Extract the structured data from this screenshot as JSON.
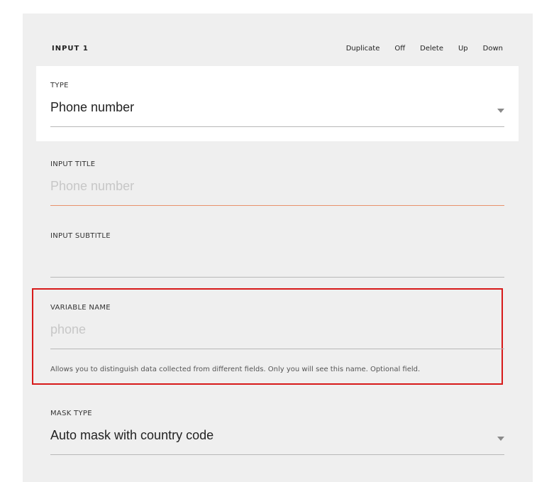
{
  "header": {
    "title": "INPUT 1",
    "actions": [
      "Duplicate",
      "Off",
      "Delete",
      "Up",
      "Down"
    ]
  },
  "fields": {
    "type": {
      "label": "TYPE",
      "value": "Phone number"
    },
    "input_title": {
      "label": "INPUT TITLE",
      "placeholder": "Phone number"
    },
    "input_subtitle": {
      "label": "INPUT SUBTITLE",
      "value": ""
    },
    "variable_name": {
      "label": "VARIABLE NAME",
      "placeholder": "phone",
      "hint": "Allows you to distinguish data collected from different fields. Only you will see this name. Optional field."
    },
    "mask_type": {
      "label": "MASK TYPE",
      "value": "Auto mask with country code"
    }
  },
  "colors": {
    "panel_bg": "#efefef",
    "accent_line": "#e8926b",
    "highlight_border": "#d71a1a"
  }
}
